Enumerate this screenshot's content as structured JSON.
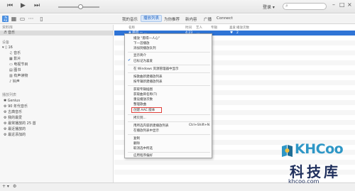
{
  "titlebar": {
    "prev_icon": "⏮",
    "play_icon": "▶",
    "next_icon": "⏭",
    "apple_icon": "",
    "account_label": "登录 ▾",
    "search_glyph": "⌕",
    "minimize": "–",
    "maximize": "□",
    "close": "×"
  },
  "navbar": {
    "icons": [
      {
        "name": "music-icon",
        "glyph": "♫",
        "active": true
      },
      {
        "name": "film-icon",
        "glyph": "▦",
        "active": false
      },
      {
        "name": "tv-icon",
        "glyph": "▭",
        "active": false
      },
      {
        "name": "more-icon",
        "glyph": "···",
        "active": false
      },
      {
        "name": "device-icon",
        "glyph": "▯",
        "active": false
      }
    ],
    "tabs": [
      "我的音乐",
      "播放列表",
      "为你推荐",
      "新内容",
      "广播",
      "Connect"
    ],
    "active_tab": "播放列表"
  },
  "sidebar": {
    "library_header": "资料库",
    "library_item": "♬ 音乐",
    "devices_header": "设备",
    "device_name": "▾ ▯ 16",
    "device_items": [
      "♫ 音乐",
      "▦ 影片",
      "▭ 电视节目",
      "▤ 图书",
      "▥ 有声读物",
      "♪ 铃声"
    ],
    "playlists_header": "播放列表",
    "playlists": [
      "✱ Genius",
      "⚙ 90 年代音乐",
      "⚙ 古典音乐",
      "⚙ 我的最爱",
      "⚙ 最常播放的 25 首",
      "⚙ 最近播放的",
      "⚙ 最近添加的"
    ]
  },
  "main": {
    "columns": [
      "名称",
      "时间",
      "艺人",
      "专辑",
      "喜爱",
      "播放次数"
    ],
    "track": {
      "name": "❀ 愿得 一 ...",
      "time": "4:23",
      "artist": "...",
      "plays": "2"
    }
  },
  "context_menu": {
    "items": [
      {
        "label": "播放 \"愿得一人心\"",
        "check": false
      },
      {
        "label": "下一首播放",
        "check": false
      },
      {
        "label": "添加到播放队列",
        "check": false
      },
      {
        "sep": true
      },
      {
        "label": "显示简介",
        "check": false
      },
      {
        "label": "已标记为喜爱",
        "check": true
      },
      {
        "sep": true
      },
      {
        "label": "在 Windows 资源管理器中显示",
        "check": false
      },
      {
        "sep": true
      },
      {
        "label": "按歌曲新建播放列表",
        "check": false
      },
      {
        "label": "按专辑新建播放列表",
        "check": false
      },
      {
        "sep": true
      },
      {
        "label": "获取专辑插图",
        "check": false
      },
      {
        "label": "获取曲目名称(T)",
        "check": false
      },
      {
        "label": "重设播放次数",
        "check": false
      },
      {
        "label": "整理歌曲",
        "check": false
      },
      {
        "label": "创建 AAC 版本",
        "check": false,
        "highlight": true
      },
      {
        "sep": true
      },
      {
        "label": "拷贝到...",
        "check": false
      },
      {
        "sep": true
      },
      {
        "label": "用所选内容新建播放列表",
        "shortcut": "Ctrl+Shift+N",
        "check": false
      },
      {
        "label": "在播放列表中显示",
        "check": false
      },
      {
        "sep": true
      },
      {
        "label": "复制",
        "check": false
      },
      {
        "label": "删除",
        "check": false
      },
      {
        "label": "取消选中所选",
        "check": false
      },
      {
        "sep": true
      },
      {
        "label": "应用程序偏好",
        "check": false
      }
    ]
  },
  "bottombar": {
    "add_label": "+ ▾",
    "settings_label": "⚙"
  },
  "watermark": {
    "brand": "KHCoo",
    "cn": "科技库",
    "url": "khcoo.com"
  }
}
